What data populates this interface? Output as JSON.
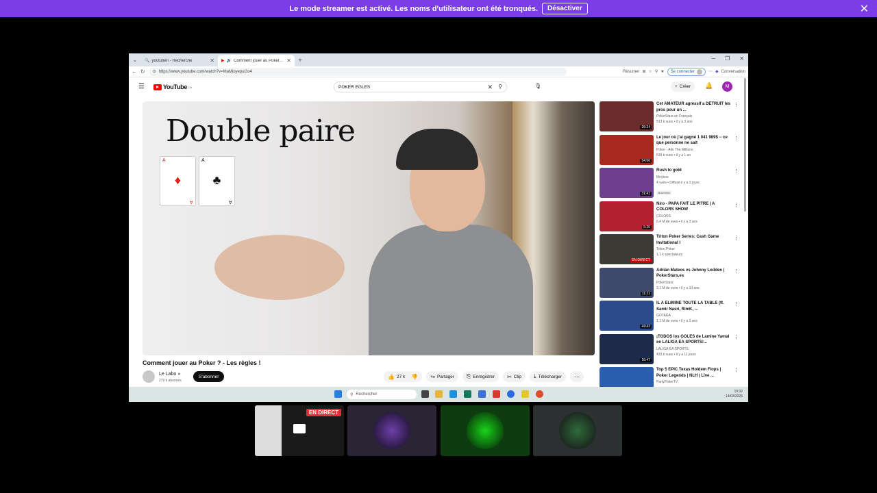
{
  "banner": {
    "message": "Le mode streamer est activé. Les noms d'utilisateur ont été tronqués.",
    "button": "Désactiver",
    "close": "✕"
  },
  "browser": {
    "tabs": [
      {
        "label": "youtuben - Recherche",
        "active": false
      },
      {
        "label": "Comment jouer au Poker ? - L",
        "active": true
      }
    ],
    "url": "https://www.youtube.com/watch?v=MaMioyepuGo4",
    "resume_label": "Résumer",
    "signin_label": "Se connecter",
    "conversation_label": "Conversation"
  },
  "youtube": {
    "logo_text": "YouTube",
    "logo_region": "CA",
    "search_value": "POKER EGLES",
    "create_label": "Créer",
    "account_initial": "M"
  },
  "video": {
    "overlay_title": "Double paire",
    "cards": [
      {
        "rank": "A",
        "suit": "♦",
        "color": "#e0201b"
      },
      {
        "rank": "A",
        "suit": "♣",
        "color": "#111111"
      }
    ],
    "title": "Comment jouer au Poker ? - Les règles !",
    "channel": "Le Labo",
    "subscribers": "279 k abonnés",
    "subscribe_label": "S'abonner",
    "likes": "27 k",
    "share_label": "Partager",
    "save_label": "Enregistrer",
    "clip_label": "Clip",
    "download_label": "Télécharger"
  },
  "recommendations": [
    {
      "title": "Cet AMATEUR agressif a DÉTRUIT les pros pour un ...",
      "channel": "PokerStars en Français",
      "stats": "513 k vues • il y a 3 ans",
      "duration": "26:24",
      "thumb": "#6b2c2c",
      "badge": ""
    },
    {
      "title": "Le jour où j'ai gagné 1 041 989$ -- ce que personne ne sait",
      "channel": "Poker - Alin The Millions",
      "stats": "539 k vues • il y a 1 an",
      "duration": "54:56",
      "thumb": "#a8271f",
      "badge": ""
    },
    {
      "title": "Rush to gold",
      "channel": "Meykoo",
      "stats": "4 vues • Diffusé il y a 3 jours",
      "duration": "31:41",
      "thumb": "#6e3f8e",
      "badge": "Nouveau"
    },
    {
      "title": "Niro - PAPA FAIT LE PITRE | A COLORS SHOW",
      "channel": "COLORS",
      "stats": "6,4 M de vues • il y a 3 ans",
      "duration": "5:25",
      "thumb": "#b3202e",
      "badge": ""
    },
    {
      "title": "Triton Poker Series: Cash Game Invitational I",
      "channel": "Triton Poker",
      "stats": "1,1 k spectateurs",
      "duration": "EN DIRECT",
      "thumb": "#3b3a35",
      "badge": ""
    },
    {
      "title": "Adrián Mateos vs Johnny Lodden | PokerStars.es",
      "channel": "PokerStars",
      "stats": "3,1 M de vues • il y a 10 ans",
      "duration": "11:21",
      "thumb": "#3d4a6b",
      "badge": ""
    },
    {
      "title": "IL A ÉLIMINÉ TOUTE LA TABLE (ft. Samir Nasri, RimK, ...",
      "channel": "GOTAGA",
      "stats": "1,1 M de vues • il y a 3 ans",
      "duration": "44:43",
      "thumb": "#2c4b8a",
      "badge": ""
    },
    {
      "title": "¡TODOS los GOLES de Lamine Yamal en LALIGA EA SPORTS!...",
      "channel": "LALIGA EA SPORTS",
      "stats": "433 k vues • il y a 11 jours",
      "duration": "16:47",
      "thumb": "#1d2a4a",
      "badge": ""
    },
    {
      "title": "Top 5 EPIC Texas Holdem Flops | Poker Legends | NLH | Live ...",
      "channel": "PartyPokerTV",
      "stats": "",
      "duration": "",
      "thumb": "#2a5fb0",
      "badge": ""
    }
  ],
  "taskbar": {
    "search_placeholder": "Rechercher",
    "time": "19:32",
    "date": "14/03/2026"
  },
  "stream_tiles": [
    {
      "label": "EN DIRECT",
      "bg": "#2a2a2a"
    },
    {
      "label": "",
      "bg": "#2b2435"
    },
    {
      "label": "",
      "bg": "#0f3b10"
    },
    {
      "label": "",
      "bg": "#2d3030"
    }
  ]
}
